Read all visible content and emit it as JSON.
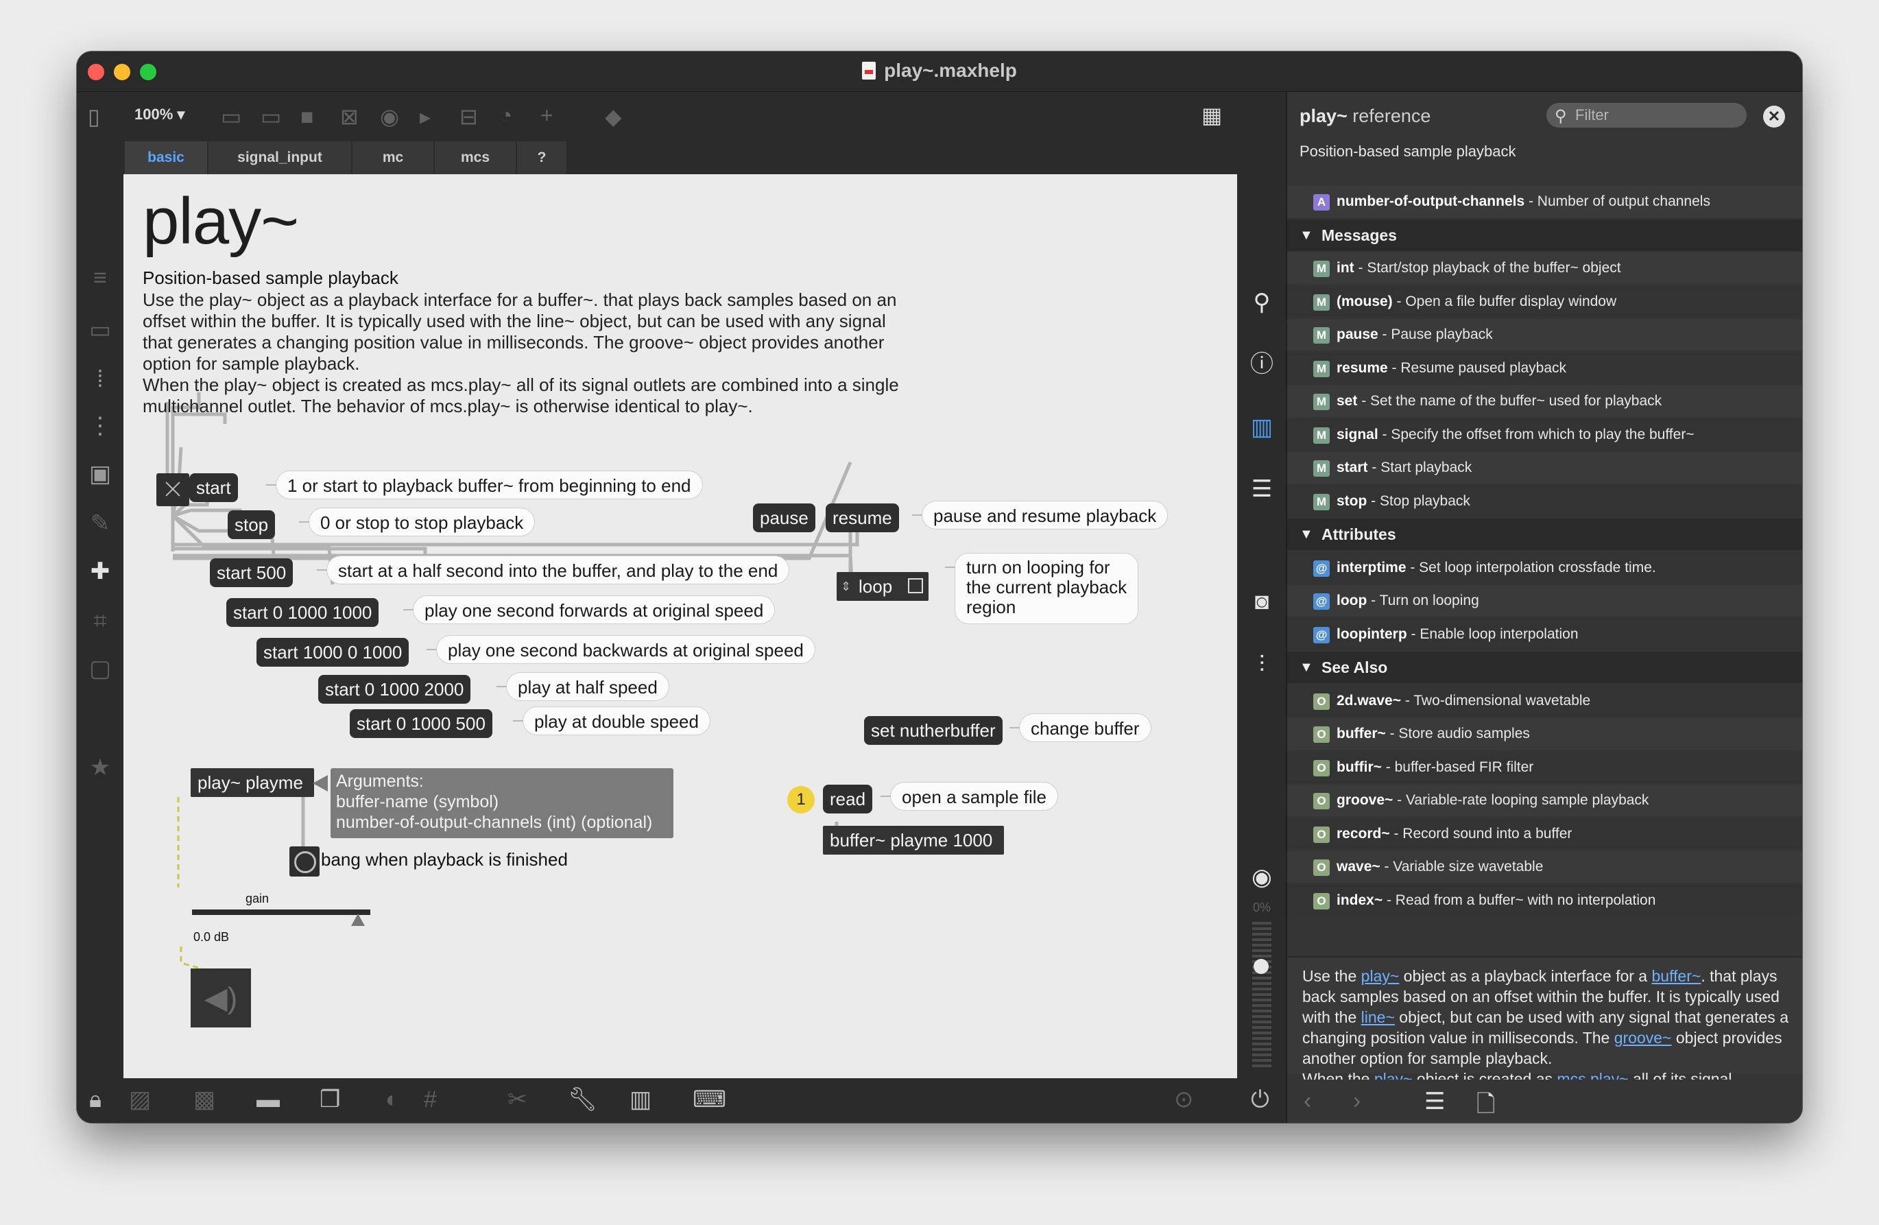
{
  "window": {
    "title": "play~.maxhelp"
  },
  "toolbar": {
    "zoom": "100%",
    "zoom_caret": "▾"
  },
  "tabs": [
    "basic",
    "signal_input",
    "mc",
    "mcs",
    "?"
  ],
  "patch": {
    "title": "play~",
    "subtitle": "Position-based sample playback",
    "description": "Use the play~ object as a playback interface for a buffer~. that plays back samples based on an offset within the buffer. It is typically used with the line~ object, but can be used with any signal that generates a changing position value in milliseconds. The groove~ object provides another option for sample playback.\nWhen the play~ object is created as mcs.play~ all of its signal outlets are combined into a single multichannel outlet. The behavior of mcs.play~ is otherwise identical to play~.",
    "messages": {
      "start": "start",
      "stop": "stop",
      "pause": "pause",
      "resume": "resume",
      "start500": "start 500",
      "start01000": "start 0 1000 1000",
      "start10000": "start 1000 0 1000",
      "start02000": "start 0 1000 2000",
      "start0500": "start 0 1000 500",
      "loop": "loop",
      "setbuffer": "set nutherbuffer",
      "read": "read"
    },
    "comments": {
      "start": "1 or start to playback buffer~ from beginning to end",
      "stop": "0 or stop to stop playback",
      "pause": "pause and resume playback",
      "start500": "start at a half second into the buffer, and play to the end",
      "forward": "play one second forwards at original speed",
      "backward": "play one second backwards at original speed",
      "half": "play at half speed",
      "double": "play at double speed",
      "loop": "turn on looping for\nthe current playback\nregion",
      "buffer": "change  buffer",
      "read": "open a sample file",
      "bang": "bang when playback is finished"
    },
    "objects": {
      "play": "play~ playme",
      "buffer": "buffer~ playme 1000"
    },
    "arguments": {
      "head": "Arguments:",
      "arg1": "buffer-name (symbol)",
      "arg2": "number-of-output-channels (int) (optional)"
    },
    "gain_label": "gain",
    "gain_value_fraction": 0.93,
    "db_label": "0.0 dB",
    "step_badge": "1"
  },
  "sidebar_right": {
    "cpu": "0%"
  },
  "reference": {
    "title_bold": "play~",
    "title_rest": " reference",
    "filter_placeholder": "Filter",
    "summary": "Position-based sample playback",
    "rows": [
      {
        "kind": "row",
        "badge": "A",
        "color": "#8d7ad8",
        "name": "number-of-output-channels",
        "desc": " - Number of output channels"
      },
      {
        "kind": "sec",
        "label": "Messages"
      },
      {
        "kind": "row",
        "badge": "M",
        "color": "#7aa08a",
        "name": "int",
        "desc": " - Start/stop playback of the buffer~ object"
      },
      {
        "kind": "row",
        "badge": "M",
        "color": "#7aa08a",
        "name": "(mouse)",
        "desc": " - Open a file buffer display window"
      },
      {
        "kind": "row",
        "badge": "M",
        "color": "#7aa08a",
        "name": "pause",
        "desc": " - Pause playback"
      },
      {
        "kind": "row",
        "badge": "M",
        "color": "#7aa08a",
        "name": "resume",
        "desc": " - Resume paused playback"
      },
      {
        "kind": "row",
        "badge": "M",
        "color": "#7aa08a",
        "name": "set",
        "desc": " - Set the name of the buffer~ used for playback"
      },
      {
        "kind": "row",
        "badge": "M",
        "color": "#7aa08a",
        "name": "signal",
        "desc": " - Specify the offset from which to play the buffer~"
      },
      {
        "kind": "row",
        "badge": "M",
        "color": "#7aa08a",
        "name": "start",
        "desc": " - Start playback"
      },
      {
        "kind": "row",
        "badge": "M",
        "color": "#7aa08a",
        "name": "stop",
        "desc": " - Stop playback"
      },
      {
        "kind": "sec",
        "label": "Attributes"
      },
      {
        "kind": "row",
        "badge": "@",
        "color": "#4f8fd6",
        "name": "interptime",
        "desc": " - Set loop interpolation crossfade time."
      },
      {
        "kind": "row",
        "badge": "@",
        "color": "#4f8fd6",
        "name": "loop",
        "desc": " - Turn on looping"
      },
      {
        "kind": "row",
        "badge": "@",
        "color": "#4f8fd6",
        "name": "loopinterp",
        "desc": " - Enable loop interpolation"
      },
      {
        "kind": "sec",
        "label": "See Also"
      },
      {
        "kind": "row",
        "badge": "O",
        "color": "#8fa77e",
        "name": "2d.wave~",
        "desc": " - Two-dimensional wavetable"
      },
      {
        "kind": "row",
        "badge": "O",
        "color": "#8fa77e",
        "name": "buffer~",
        "desc": " - Store audio samples"
      },
      {
        "kind": "row",
        "badge": "O",
        "color": "#8fa77e",
        "name": "buffir~",
        "desc": " - buffer-based FIR filter"
      },
      {
        "kind": "row",
        "badge": "O",
        "color": "#8fa77e",
        "name": "groove~",
        "desc": " - Variable-rate looping sample playback"
      },
      {
        "kind": "row",
        "badge": "O",
        "color": "#8fa77e",
        "name": "record~",
        "desc": " - Record sound into a buffer"
      },
      {
        "kind": "row",
        "badge": "O",
        "color": "#8fa77e",
        "name": "wave~",
        "desc": " - Variable size wavetable"
      },
      {
        "kind": "row",
        "badge": "O",
        "color": "#8fa77e",
        "name": "index~",
        "desc": " - Read from a buffer~ with no interpolation"
      }
    ],
    "body": {
      "p1_a": "Use the ",
      "link_play": "play~",
      "p1_b": " object as a playback interface for a ",
      "link_buffer": "buffer~",
      "p1_c": ". that plays back samples based on an offset within the buffer. It is typically used with the ",
      "link_line": "line~",
      "p1_d": " object, but can be used with any signal that generates a changing position value in milliseconds. The ",
      "link_groove": "groove~",
      "p1_e": " object provides another option for sample playback.",
      "p2_a": "When the ",
      "link_play2": "play~",
      "p2_b": " object is created as ",
      "link_mcs": "mcs.play~",
      "p2_c": " all of its signal"
    }
  },
  "colors": {
    "accent": "#5aa7ff",
    "patch_bg": "#ebebeb",
    "object": "#2f2f2f",
    "badge": "#f1d23a"
  }
}
